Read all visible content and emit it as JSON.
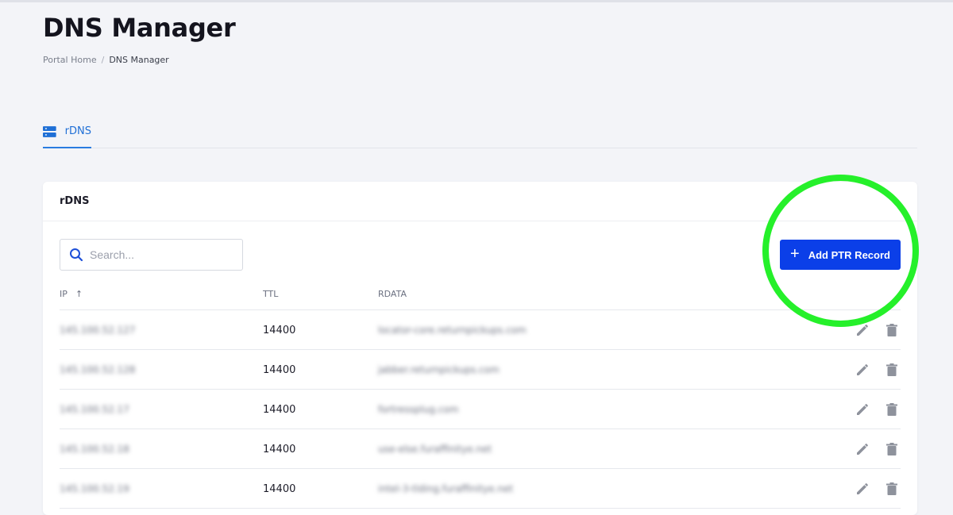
{
  "page": {
    "title": "DNS Manager",
    "breadcrumb": [
      {
        "label": "Portal Home"
      },
      {
        "label": "DNS Manager"
      }
    ]
  },
  "tabs": [
    {
      "label": "rDNS",
      "icon": "server-icon",
      "active": true
    }
  ],
  "card": {
    "title": "rDNS",
    "search": {
      "placeholder": "Search...",
      "value": ""
    },
    "add_button": {
      "label": "Add PTR Record",
      "icon": "plus-icon"
    }
  },
  "table": {
    "columns": {
      "ip": "IP",
      "ttl": "TTL",
      "rdata": "RDATA"
    },
    "sort_icon": "arrow-up-icon",
    "rows": [
      {
        "ip": "145.100.52.127",
        "ttl": "14400",
        "rdata": "locator-core.returnpickups.com"
      },
      {
        "ip": "145.100.52.128",
        "ttl": "14400",
        "rdata": "jabber.returnpickups.com"
      },
      {
        "ip": "145.100.52.17",
        "ttl": "14400",
        "rdata": "fortressplug.com"
      },
      {
        "ip": "145.100.52.18",
        "ttl": "14400",
        "rdata": "use-else.furaffinitye.net"
      },
      {
        "ip": "145.100.52.19",
        "ttl": "14400",
        "rdata": "intel-3-tlding.furaffinitye.net"
      }
    ],
    "row_action_icons": [
      "pencil-icon",
      "trash-icon"
    ]
  },
  "colors": {
    "accent": "#0b3fe8",
    "tab_active": "#2a7ce0",
    "highlight_ring": "#25f02a",
    "background": "#f3f4f8"
  }
}
